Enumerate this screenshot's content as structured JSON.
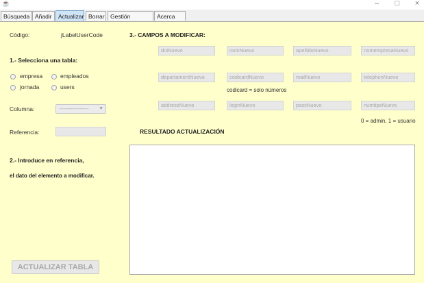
{
  "window": {
    "minimize": "–",
    "maximize": "□",
    "close": "×"
  },
  "tabs": [
    {
      "label": "Búsqueda",
      "selected": false
    },
    {
      "label": "Añadir",
      "selected": false
    },
    {
      "label": "Actualizar",
      "selected": true
    },
    {
      "label": "Borrar",
      "selected": false
    },
    {
      "label": "Gestión usuario",
      "selected": false
    },
    {
      "label": "Acerca de",
      "selected": false
    }
  ],
  "left": {
    "codigo_label": "Código:",
    "codigo_value": "jLabelUserCode",
    "step1_title": "1.- Selecciona una tabla:",
    "radios": [
      "empresa",
      "empleados",
      "jornada",
      "users"
    ],
    "columna_label": "Columna:",
    "columna_value": "----------------",
    "referencia_label": "Referencia:",
    "referencia_value": "",
    "step2_line1": "2.- Introduce en referencia,",
    "step2_line2": "el dato del elemento a modificar.",
    "update_button": "ACTUALIZAR TABLA"
  },
  "right": {
    "step3_title": "3.- CAMPOS A MODIFICAR:",
    "fields_row1": [
      "dniNuevo",
      "nomNuevo",
      "apellidoNuevo",
      "nomempresaNuevo"
    ],
    "fields_row2": [
      "departamentNuevo",
      "codicardNuevo",
      "mailNuevo",
      "telephonNuevo"
    ],
    "codicard_hint": "codicard = solo números",
    "fields_row3": [
      "addressNuevo",
      "loginNuevo",
      "passNuevo",
      "numtipeNuevo"
    ],
    "numtipe_hint": "0 = admin, 1 = usuario",
    "result_title": "RESULTADO ACTUALIZACIÓN",
    "result_text": ""
  },
  "colors": {
    "panel_bg": "#ffffcc",
    "selected_tab": "#cfe5f7",
    "field_bg": "#e8e8e8"
  }
}
